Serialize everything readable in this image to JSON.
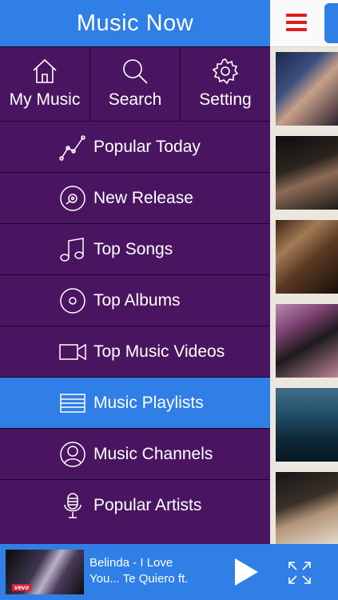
{
  "drawer": {
    "title": "Music Now",
    "tabs": [
      {
        "label": "My Music",
        "icon": "home-icon"
      },
      {
        "label": "Search",
        "icon": "search-icon"
      },
      {
        "label": "Setting",
        "icon": "gear-icon"
      }
    ],
    "items": [
      {
        "label": "Popular Today",
        "icon": "trend-chart-icon",
        "active": false
      },
      {
        "label": "New Release",
        "icon": "disc-icon",
        "active": false
      },
      {
        "label": "Top Songs",
        "icon": "music-note-icon",
        "active": false
      },
      {
        "label": "Top Albums",
        "icon": "album-icon",
        "active": false
      },
      {
        "label": "Top Music Videos",
        "icon": "video-camera-icon",
        "active": false
      },
      {
        "label": "Music Playlists",
        "icon": "playlist-icon",
        "active": true
      },
      {
        "label": "Music Channels",
        "icon": "user-circle-icon",
        "active": false
      },
      {
        "label": "Popular Artists",
        "icon": "microphone-icon",
        "active": false
      }
    ]
  },
  "player": {
    "title": "Belinda - I Love\nYou... Te Quiero ft.",
    "badge": "vevo",
    "play_icon": "play-icon",
    "expand_icon": "expand-icon"
  },
  "content": {
    "menu_icon": "hamburger-icon",
    "thumbnails": [
      "video-thumb-1",
      "video-thumb-2",
      "video-thumb-3",
      "video-thumb-4",
      "video-thumb-5",
      "video-thumb-6"
    ]
  },
  "colors": {
    "accent": "#2f7fe6",
    "drawer_bg": "#4a1560",
    "hamburger": "#e21b1b"
  }
}
